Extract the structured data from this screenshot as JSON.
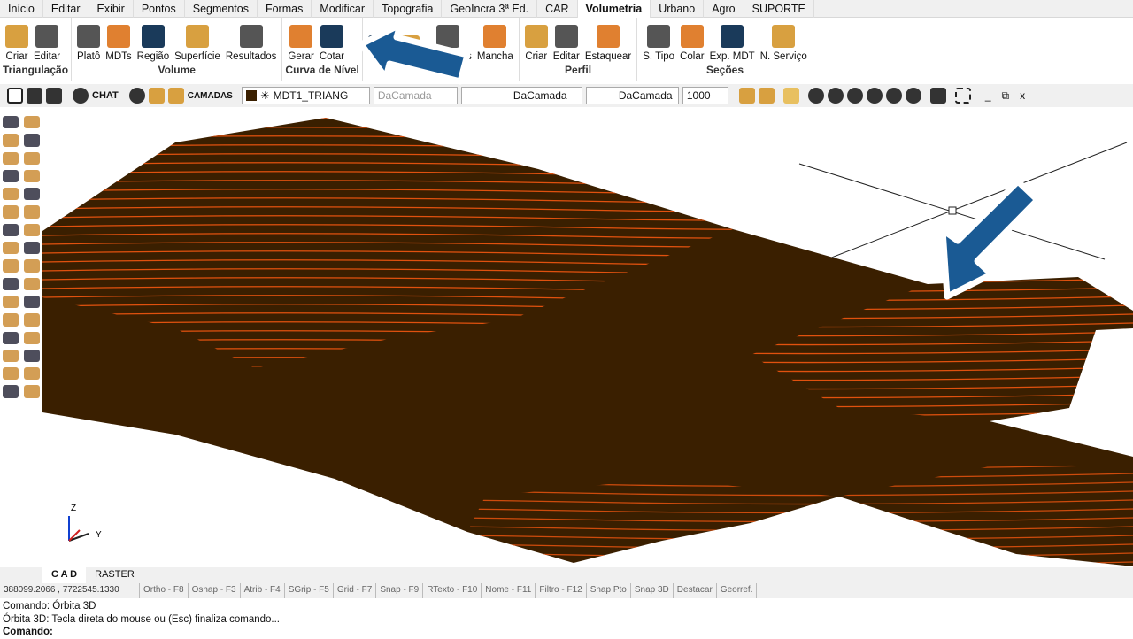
{
  "tabs": [
    "Início",
    "Editar",
    "Exibir",
    "Pontos",
    "Segmentos",
    "Formas",
    "Modificar",
    "Topografia",
    "GeoIncra 3ª Ed.",
    "CAR",
    "Volumetria",
    "Urbano",
    "Agro",
    "SUPORTE"
  ],
  "active_tab": "Volumetria",
  "ribbon": [
    {
      "label": "Triangulação",
      "buttons": [
        "Criar",
        "Editar"
      ]
    },
    {
      "label": "Volume",
      "buttons": [
        "Platô",
        "MDTs",
        "Região",
        "Superfície",
        "Resultados"
      ]
    },
    {
      "label": "Curva de Nível",
      "buttons": [
        "Gerar",
        "Cotar"
      ]
    },
    {
      "label": "",
      "buttons": [
        "",
        "",
        "Elevações",
        "Mancha"
      ]
    },
    {
      "label": "Perfil",
      "buttons": [
        "Criar",
        "Editar",
        "Estaquear"
      ]
    },
    {
      "label": "Seções",
      "buttons": [
        "S. Tipo",
        "Colar",
        "Exp. MDT",
        "N. Serviço"
      ]
    }
  ],
  "toolbar": {
    "chat": "CHAT",
    "layers": "CAMADAS",
    "layer": "MDT1_TRIANG",
    "color": "DaCamada",
    "linetype": "DaCamada",
    "lineweight": "DaCamada",
    "scale": "1000"
  },
  "axis": {
    "z": "Z",
    "y": "Y"
  },
  "cad_tabs": [
    "C A D",
    "RASTER"
  ],
  "coords": "388099.2066 , 7722545.1330",
  "status": [
    "Ortho - F8",
    "Osnap - F3",
    "Atrib - F4",
    "SGrip - F5",
    "Grid - F7",
    "Snap - F9",
    "RTexto - F10",
    "Nome - F11",
    "Filtro - F12",
    "Snap Pto",
    "Snap 3D",
    "Destacar",
    "Georref."
  ],
  "command": [
    "Comando: Órbita 3D",
    "Órbita 3D: Tecla direta do mouse ou (Esc) finaliza comando...",
    "Comando:"
  ],
  "colors": {
    "terrain": "#3a1f00",
    "contour": "#ff5a10",
    "accent_arrow": "#1a5a94"
  }
}
